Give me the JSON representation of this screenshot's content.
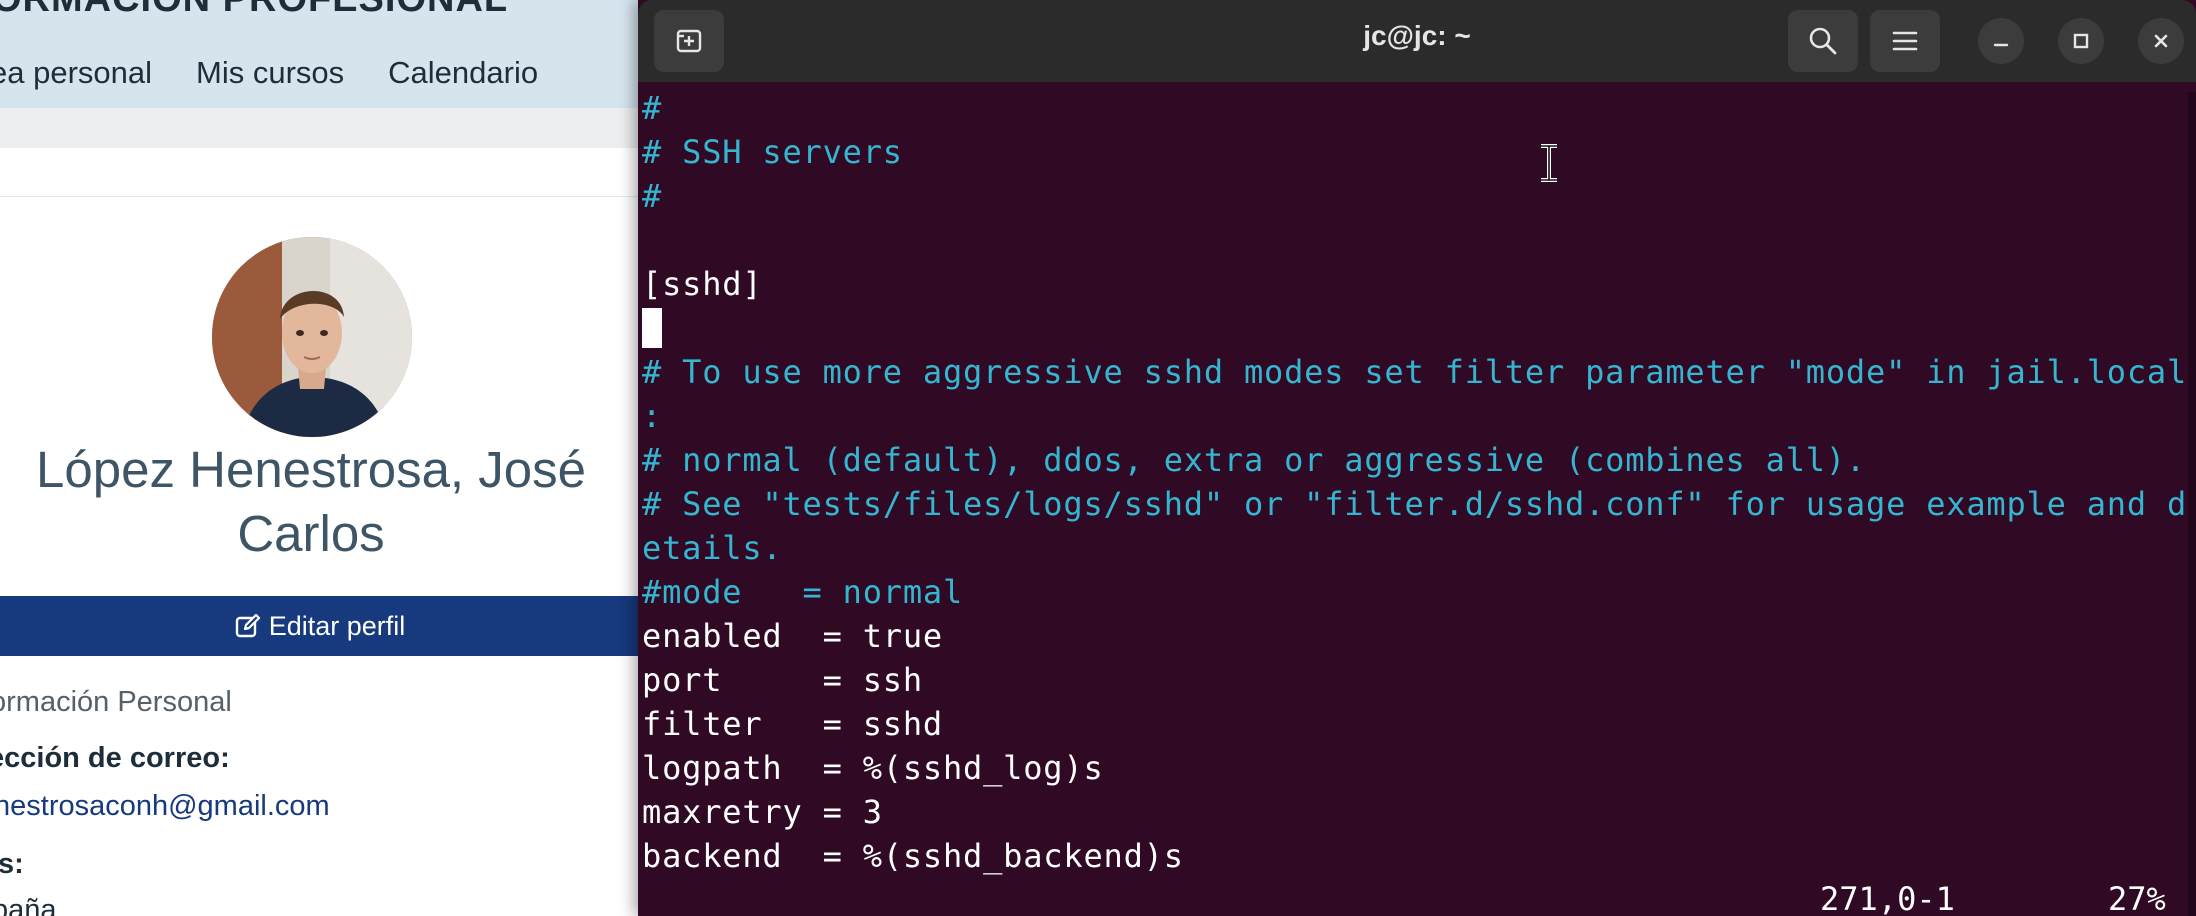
{
  "browser": {
    "site_title": "ORMACIÓN PROFESIONAL",
    "nav": [
      "ea personal",
      "Mis cursos",
      "Calendario"
    ],
    "profile": {
      "name": "López Henestrosa, José Carlos",
      "edit_button": "Editar perfil",
      "section_title": "ormación Personal",
      "email_label": "ección de correo:",
      "email_value": "nestrosaconh@gmail.com",
      "country_label": "ís:",
      "country_value": "paña"
    }
  },
  "terminal": {
    "title": "jc@jc: ~",
    "colors": {
      "background": "#300a24",
      "comment": "#35b5d0",
      "text": "#ffffff",
      "titlebar": "#2b2b2b"
    },
    "lines": [
      {
        "text": "#",
        "type": "comment"
      },
      {
        "text": "# SSH servers",
        "type": "comment"
      },
      {
        "text": "#",
        "type": "comment"
      },
      {
        "text": "",
        "type": "text"
      },
      {
        "text": "[sshd]",
        "type": "text"
      },
      {
        "text": "",
        "type": "text"
      },
      {
        "text": "# To use more aggressive sshd modes set filter parameter \"mode\" in jail.local",
        "type": "comment"
      },
      {
        "text": ":",
        "type": "comment"
      },
      {
        "text": "# normal (default), ddos, extra or aggressive (combines all).",
        "type": "comment"
      },
      {
        "text": "# See \"tests/files/logs/sshd\" or \"filter.d/sshd.conf\" for usage example and d",
        "type": "comment"
      },
      {
        "text": "etails.",
        "type": "comment"
      },
      {
        "text": "#mode   = normal",
        "type": "comment"
      },
      {
        "text": "enabled  = true",
        "type": "text"
      },
      {
        "text": "port     = ssh",
        "type": "text"
      },
      {
        "text": "filter   = sshd",
        "type": "text"
      },
      {
        "text": "logpath  = %(sshd_log)s",
        "type": "text"
      },
      {
        "text": "maxretry = 3",
        "type": "text"
      },
      {
        "text": "backend  = %(sshd_backend)s",
        "type": "text"
      }
    ],
    "status": {
      "position": "271,0-1",
      "percent": "27%"
    }
  }
}
